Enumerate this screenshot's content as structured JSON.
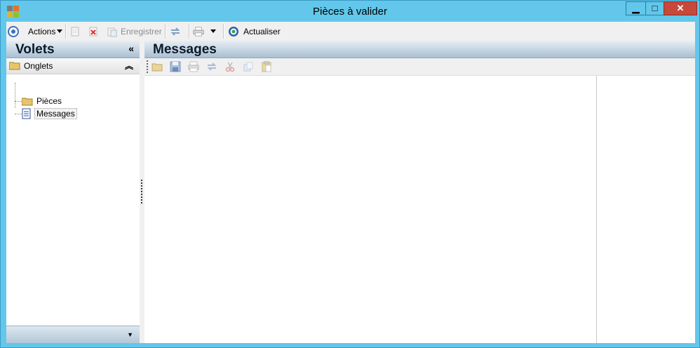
{
  "window": {
    "title": "Pièces à valider",
    "controls": {
      "minimize": "▁",
      "maximize": "□",
      "close": "✕"
    }
  },
  "toolbar": {
    "actions_label": "Actions",
    "save_label": "Enregistrer",
    "refresh_label": "Actualiser"
  },
  "left_pane": {
    "title": "Volets",
    "group_label": "Onglets",
    "tree_items": [
      {
        "label": "Pièces",
        "icon": "folder-icon"
      },
      {
        "label": "Messages",
        "icon": "document-icon",
        "selected": true
      }
    ]
  },
  "right_pane": {
    "title": "Messages"
  },
  "colors": {
    "titlebar": "#62c7ea",
    "header_gradient_top": "#e7eef4",
    "header_gradient_bottom": "#a9bfd2"
  }
}
